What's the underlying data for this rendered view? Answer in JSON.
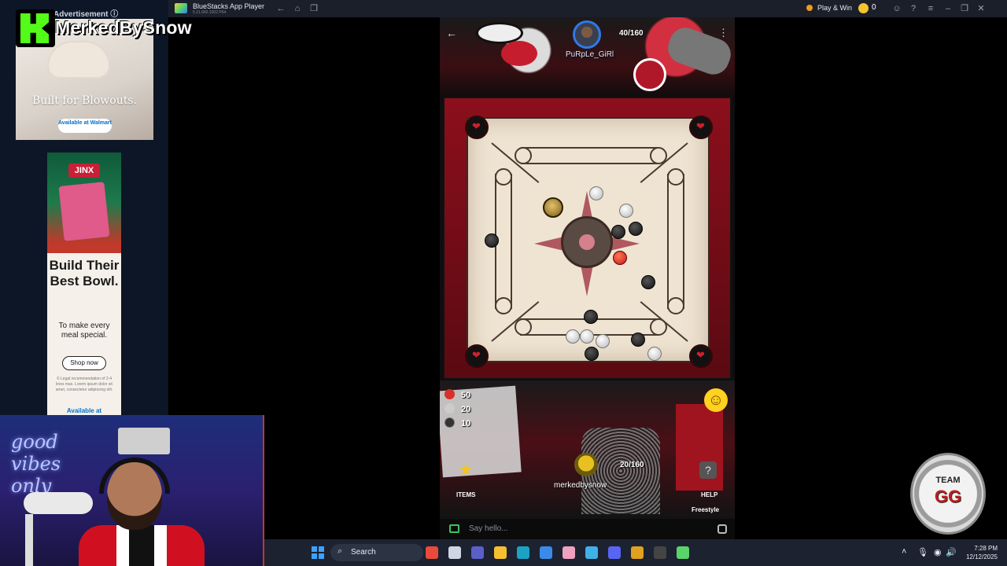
{
  "ad_panel": {
    "label": "Advertisement ⓘ",
    "ad1": {
      "tagline": "Built for Blowouts.",
      "retailer": "Available at Walmart"
    },
    "ad2": {
      "brand": "JINX",
      "headline": "Build Their Best Bowl.",
      "sub": "To make every meal special.",
      "cta": "Shop now",
      "fine_print": "© Legal recommendation of 2-4 lines max. Lorem ipsum dolor sit amet, consectetur adipiscing elit.",
      "availability": "Available at"
    }
  },
  "stream_overlay": {
    "streamer_name": "MerkedBySnow"
  },
  "titlebar": {
    "app_title": "BlueStacks App Player",
    "version": "5.21.660.1002 P64",
    "play_win_label": "Play & Win",
    "coin_count": "0",
    "icons": [
      "back-icon",
      "home-icon",
      "multi-instance-icon",
      "avatar-icon",
      "help-icon",
      "menu-icon",
      "minimize-icon",
      "restore-icon",
      "close-icon"
    ]
  },
  "game": {
    "opponent": {
      "name": "PuRpLe_GiRl",
      "score": "40/160"
    },
    "player": {
      "name": "merkedbysnow",
      "score": "20/160"
    },
    "pocketed": [
      {
        "color": "#d8302a",
        "value": "50"
      },
      {
        "color": "#cccccc",
        "value": "20"
      },
      {
        "color": "#333333",
        "value": "10"
      }
    ],
    "items_label": "ITEMS",
    "help_label": "HELP",
    "help_glyph": "?",
    "mode_label": "Freestyle",
    "emoji_glyph": "☺",
    "back_glyph": "←",
    "more_glyph": "⋮",
    "star_glyph": "★"
  },
  "chat": {
    "placeholder": "Say hello..."
  },
  "badge": {
    "line1": "TEAM",
    "line2": "GG"
  },
  "webcam": {
    "neon_text": "good vibes only"
  },
  "taskbar": {
    "search_label": "Search",
    "search_glyph": "⌕",
    "time": "7:28 PM",
    "date": "12/12/2025",
    "tray": {
      "chevron": "˄",
      "mic": "🎙",
      "wifi": "◉",
      "volume": "🔊"
    },
    "pinned": [
      {
        "name": "copilot-icon",
        "color": "#e84a3c"
      },
      {
        "name": "task-view-icon",
        "color": "#cfd6e2"
      },
      {
        "name": "teams-icon",
        "color": "#5b5fc7"
      },
      {
        "name": "file-explorer-icon",
        "color": "#f5c030"
      },
      {
        "name": "edge-icon",
        "color": "#1ba3c4"
      },
      {
        "name": "store-icon",
        "color": "#3a8be8"
      },
      {
        "name": "pink-app-icon",
        "color": "#f0a0c0"
      },
      {
        "name": "copilot-app-icon",
        "color": "#3fb0e8"
      },
      {
        "name": "discord-icon",
        "color": "#5865f2"
      },
      {
        "name": "slack-icon",
        "color": "#e0a020"
      },
      {
        "name": "obs-icon",
        "color": "#444444"
      },
      {
        "name": "bluestacks-icon",
        "color": "#5ad36b"
      }
    ]
  }
}
